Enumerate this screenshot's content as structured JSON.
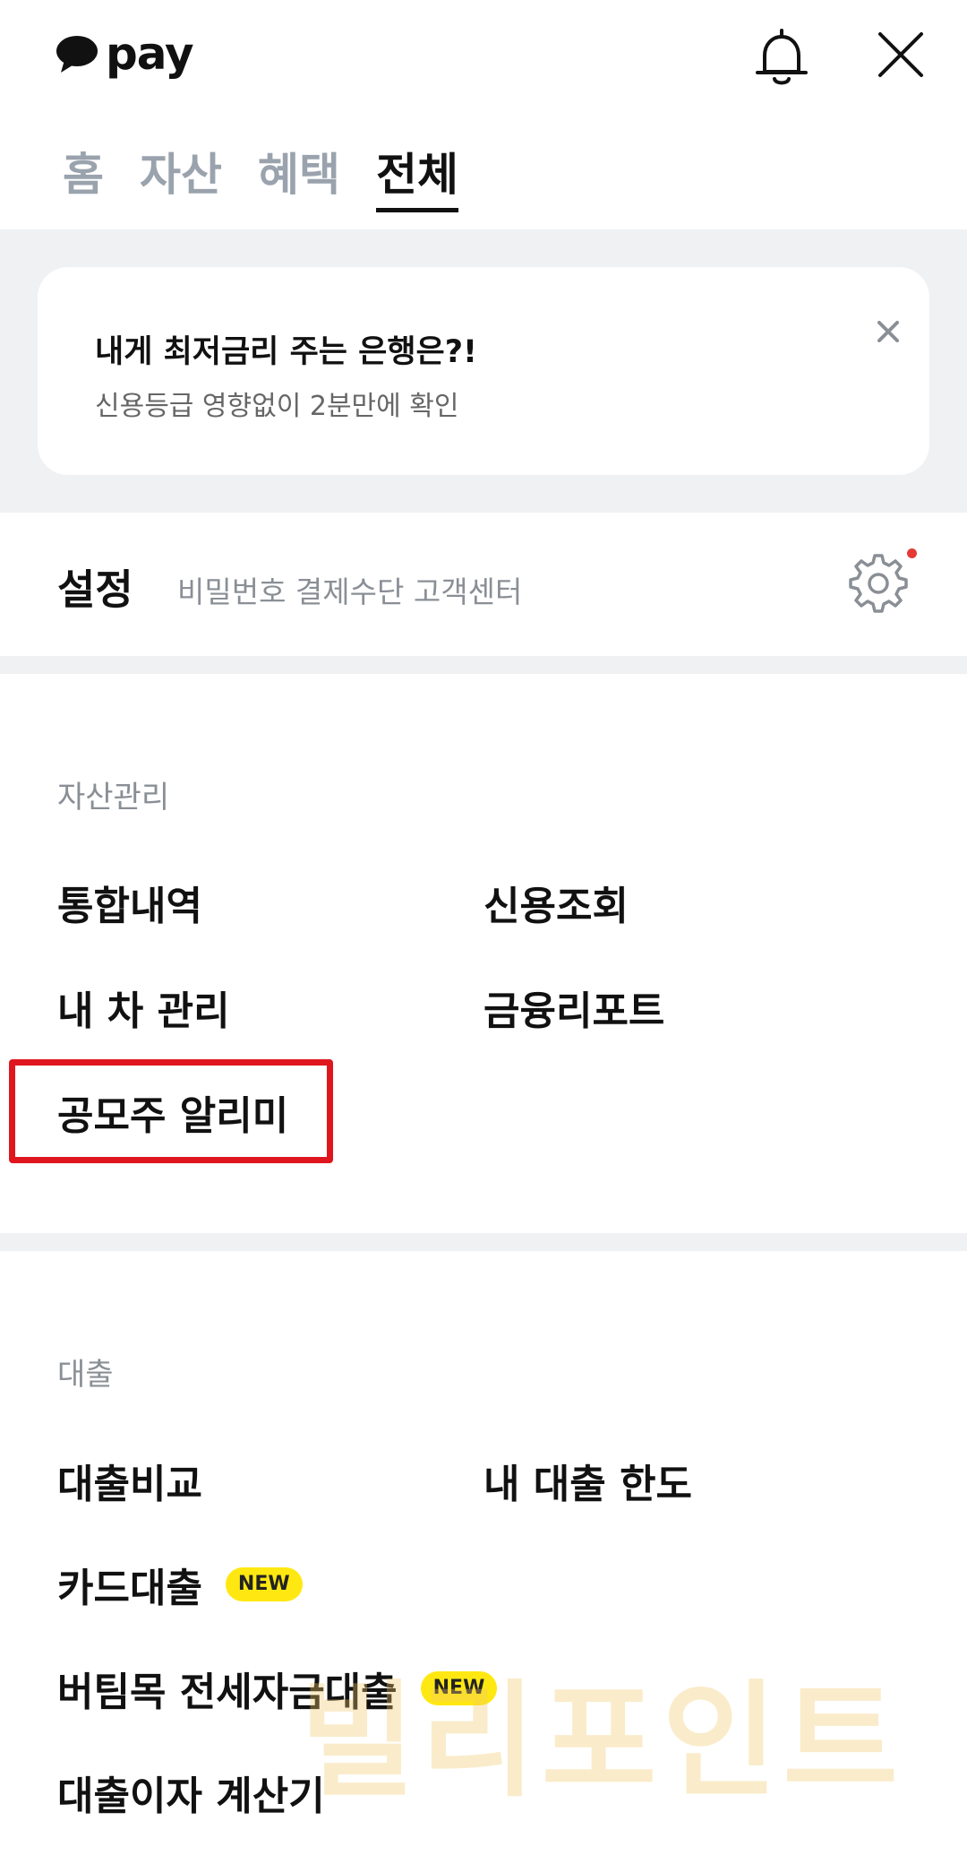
{
  "header": {
    "logo_text": "pay",
    "bell_icon": "bell-icon",
    "close_icon": "close-icon"
  },
  "tabs": [
    {
      "label": "홈",
      "active": false
    },
    {
      "label": "자산",
      "active": false
    },
    {
      "label": "혜택",
      "active": false
    },
    {
      "label": "전체",
      "active": true
    }
  ],
  "banner": {
    "title": "내게 최저금리 주는 은행은?!",
    "subtitle": "신용등급 영향없이 2분만에 확인"
  },
  "settings": {
    "title": "설정",
    "description": "비밀번호 결제수단 고객센터"
  },
  "asset_section": {
    "label": "자산관리",
    "items": [
      "통합내역",
      "신용조회",
      "내 차 관리",
      "금융리포트",
      "공모주 알리미"
    ]
  },
  "loan_section": {
    "label": "대출",
    "items": [
      {
        "label": "대출비교"
      },
      {
        "label": "내 대출 한도"
      },
      {
        "label": "카드대출",
        "badge": "NEW"
      },
      {
        "label": "버팀목 전세자금대출",
        "badge": "NEW"
      },
      {
        "label": "대출이자 계산기"
      }
    ]
  },
  "watermark": "빌리포인트",
  "colors": {
    "badge": "#ffe812",
    "highlight": "#e0161e",
    "notification_dot": "#e53935",
    "inactive_tab": "#9aa3ad"
  }
}
